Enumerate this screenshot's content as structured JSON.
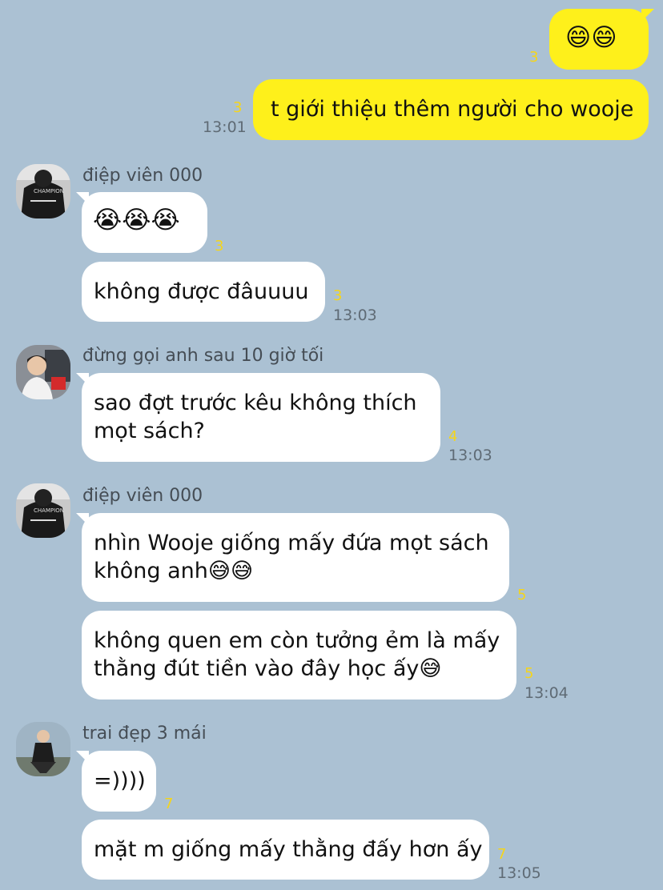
{
  "messages": {
    "m1": {
      "text": "😄😄",
      "unread": "3"
    },
    "m2": {
      "text": "t giới thiệu thêm người cho wooje",
      "unread": "3",
      "time": "13:01"
    },
    "m3": {
      "sender": "điệp viên 000",
      "avatar_icon": "user-avatar-black-hoodie-icon",
      "text": "😭😭😭",
      "unread": "3"
    },
    "m4": {
      "text": "không được đâuuuu",
      "unread": "3",
      "time": "13:03"
    },
    "m5": {
      "sender": "đừng gọi anh sau 10 giờ tối",
      "avatar_icon": "user-avatar-man-red-bag-icon",
      "text": "sao đợt trước kêu không thích\nmọt sách?",
      "unread": "4",
      "time": "13:03"
    },
    "m6": {
      "sender": "điệp viên 000",
      "avatar_icon": "user-avatar-black-hoodie-icon",
      "text": "nhìn Wooje giống mấy đứa mọt sách\nkhông anh😅😅",
      "unread": "5"
    },
    "m7": {
      "text": "không quen em còn tưởng ẻm là mấy\nthằng đút tiền vào đây học ấy😅",
      "unread": "5",
      "time": "13:04"
    },
    "m8": {
      "sender": "trai đẹp 3 mái",
      "avatar_icon": "user-avatar-man-crouching-icon",
      "text": "=))))",
      "unread": "7"
    },
    "m9": {
      "text": "mặt m giống mấy thằng đấy hơn ấy",
      "unread": "7",
      "time": "13:05"
    }
  },
  "colors": {
    "background": "#abc1d3",
    "outgoing_bubble": "#fef01b",
    "incoming_bubble": "#ffffff",
    "unread_count": "#f5d51b",
    "timestamp": "#5f6b75"
  }
}
